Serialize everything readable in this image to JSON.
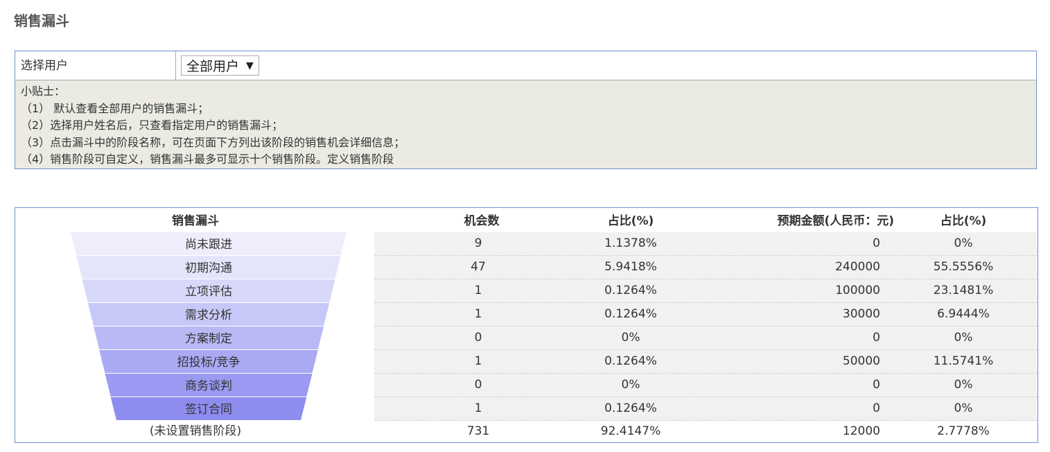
{
  "page": {
    "title": "销售漏斗"
  },
  "filter": {
    "label": "选择用户",
    "select_value": "全部用户",
    "arrow": "▼",
    "tips_title": "小贴士：",
    "tips": [
      "（1） 默认查看全部用户的销售漏斗；",
      "（2）选择用户姓名后，只查看指定用户的销售漏斗；",
      "（3）点击漏斗中的阶段名称，可在页面下方列出该阶段的销售机会详细信息；",
      "（4）销售阶段可自定义，销售漏斗最多可显示十个销售阶段。定义销售阶段"
    ]
  },
  "table": {
    "headers": {
      "funnel": "销售漏斗",
      "count": "机会数",
      "ratio": "占比(%)",
      "amount": "预期金额(人民币：元)",
      "amount_ratio": "占比(%)"
    },
    "stages": [
      {
        "name": "尚未跟进",
        "count": "9",
        "ratio": "1.1378%",
        "amount": "0",
        "amount_ratio": "0%",
        "color": "#ededfc"
      },
      {
        "name": "初期沟通",
        "count": "47",
        "ratio": "5.9418%",
        "amount": "240000",
        "amount_ratio": "55.5556%",
        "color": "#e4e4fb"
      },
      {
        "name": "立项评估",
        "count": "1",
        "ratio": "0.1264%",
        "amount": "100000",
        "amount_ratio": "23.1481%",
        "color": "#d8d8fa"
      },
      {
        "name": "需求分析",
        "count": "1",
        "ratio": "0.1264%",
        "amount": "30000",
        "amount_ratio": "6.9444%",
        "color": "#c8c8f8"
      },
      {
        "name": "方案制定",
        "count": "0",
        "ratio": "0%",
        "amount": "0",
        "amount_ratio": "0%",
        "color": "#b9b9f6"
      },
      {
        "name": "招投标/竞争",
        "count": "1",
        "ratio": "0.1264%",
        "amount": "50000",
        "amount_ratio": "11.5741%",
        "color": "#a9a9f4"
      },
      {
        "name": "商务谈判",
        "count": "0",
        "ratio": "0%",
        "amount": "0",
        "amount_ratio": "0%",
        "color": "#9a9af2"
      },
      {
        "name": "签订合同",
        "count": "1",
        "ratio": "0.1264%",
        "amount": "0",
        "amount_ratio": "0%",
        "color": "#8d8df0"
      }
    ],
    "unset": {
      "name": "(未设置销售阶段)",
      "count": "731",
      "ratio": "92.4147%",
      "amount": "12000",
      "amount_ratio": "2.7778%"
    }
  }
}
